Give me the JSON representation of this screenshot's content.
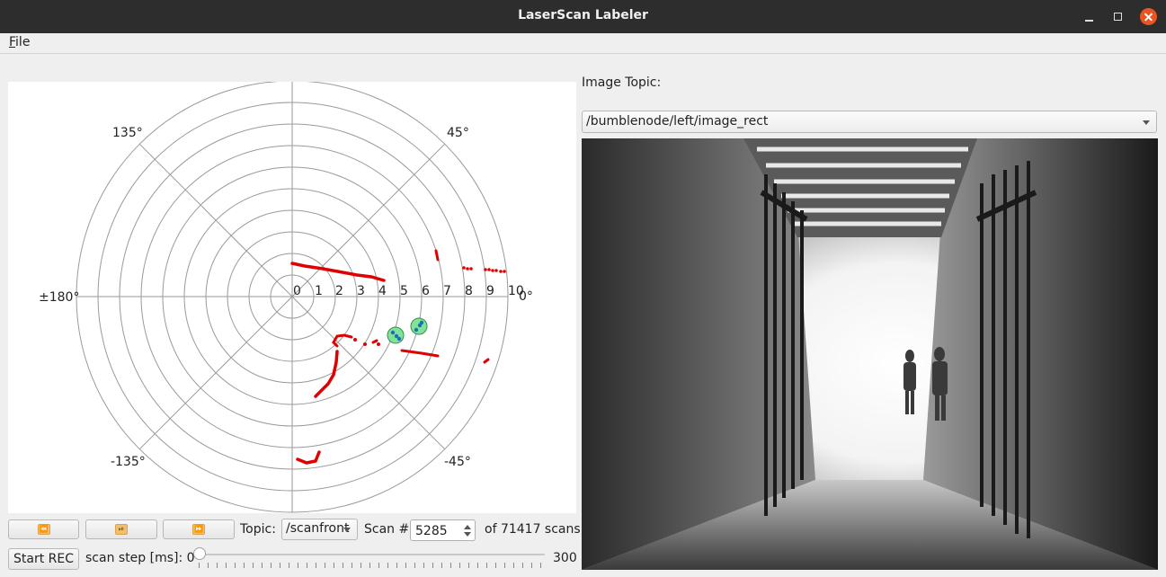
{
  "window": {
    "title": "LaserScan Labeler"
  },
  "menu": {
    "file_prefix": "F",
    "file_rest": "ile"
  },
  "polar_plot": {
    "angle_labels": [
      "45°",
      "135°",
      "±180°",
      "-135°",
      "-45°",
      "0°"
    ],
    "radial_labels": [
      "0",
      "1",
      "2",
      "3",
      "4",
      "5",
      "6",
      "7",
      "8",
      "9",
      "10"
    ],
    "scan_color": "#e00000",
    "track_color": "#7fe39a",
    "tracked_targets": 2
  },
  "controls": {
    "rewind_icon": "fast-rewind-icon",
    "play_pause_icon": "play-pause-icon",
    "fast_forward_icon": "fast-forward-icon",
    "topic_label": "Topic:",
    "topic_value": "/scanfront",
    "scan_label": "Scan #",
    "scan_value": "5285",
    "scan_total": "of 71417 scans",
    "rec_button": "Start REC",
    "step_label": "scan step [ms]: 0",
    "step_max": "300",
    "step_value": 0
  },
  "image_panel": {
    "label": "Image Topic:",
    "topic": "/bumblenode/left/image_rect"
  },
  "colors": {
    "close_button": "#e95420",
    "titlebar": "#2d2d2d"
  }
}
